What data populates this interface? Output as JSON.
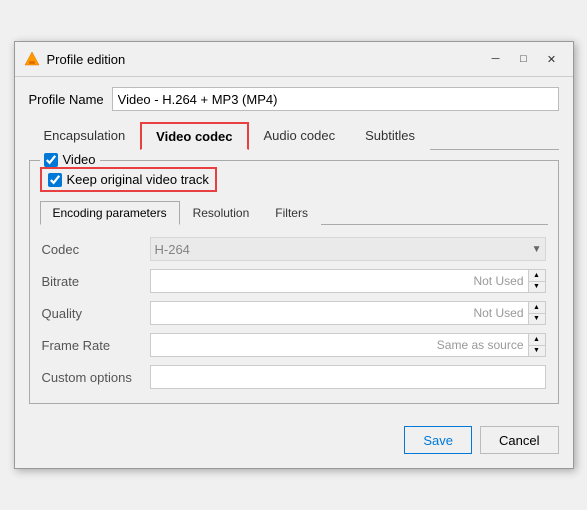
{
  "window": {
    "title": "Profile edition",
    "controls": {
      "minimize": "─",
      "maximize": "□",
      "close": "✕"
    }
  },
  "profile_name": {
    "label": "Profile Name",
    "value": "Video - H.264 + MP3 (MP4)"
  },
  "tabs": [
    {
      "id": "encapsulation",
      "label": "Encapsulation",
      "active": false
    },
    {
      "id": "video-codec",
      "label": "Video codec",
      "active": true
    },
    {
      "id": "audio-codec",
      "label": "Audio codec",
      "active": false
    },
    {
      "id": "subtitles",
      "label": "Subtitles",
      "active": false
    }
  ],
  "video_group": {
    "legend_label": "Video",
    "checked": true
  },
  "keep_original": {
    "label": "Keep original video track",
    "checked": true
  },
  "inner_tabs": [
    {
      "id": "encoding",
      "label": "Encoding parameters",
      "active": true
    },
    {
      "id": "resolution",
      "label": "Resolution",
      "active": false
    },
    {
      "id": "filters",
      "label": "Filters",
      "active": false
    }
  ],
  "encoding_form": {
    "rows": [
      {
        "id": "codec",
        "label": "Codec",
        "type": "select",
        "value": "H-264"
      },
      {
        "id": "bitrate",
        "label": "Bitrate",
        "type": "spinbox",
        "value": "Not Used"
      },
      {
        "id": "quality",
        "label": "Quality",
        "type": "spinbox",
        "value": "Not Used"
      },
      {
        "id": "framerate",
        "label": "Frame Rate",
        "type": "spinbox",
        "value": "Same as source"
      },
      {
        "id": "custom",
        "label": "Custom options",
        "type": "text",
        "value": ""
      }
    ]
  },
  "footer": {
    "save_label": "Save",
    "cancel_label": "Cancel"
  }
}
